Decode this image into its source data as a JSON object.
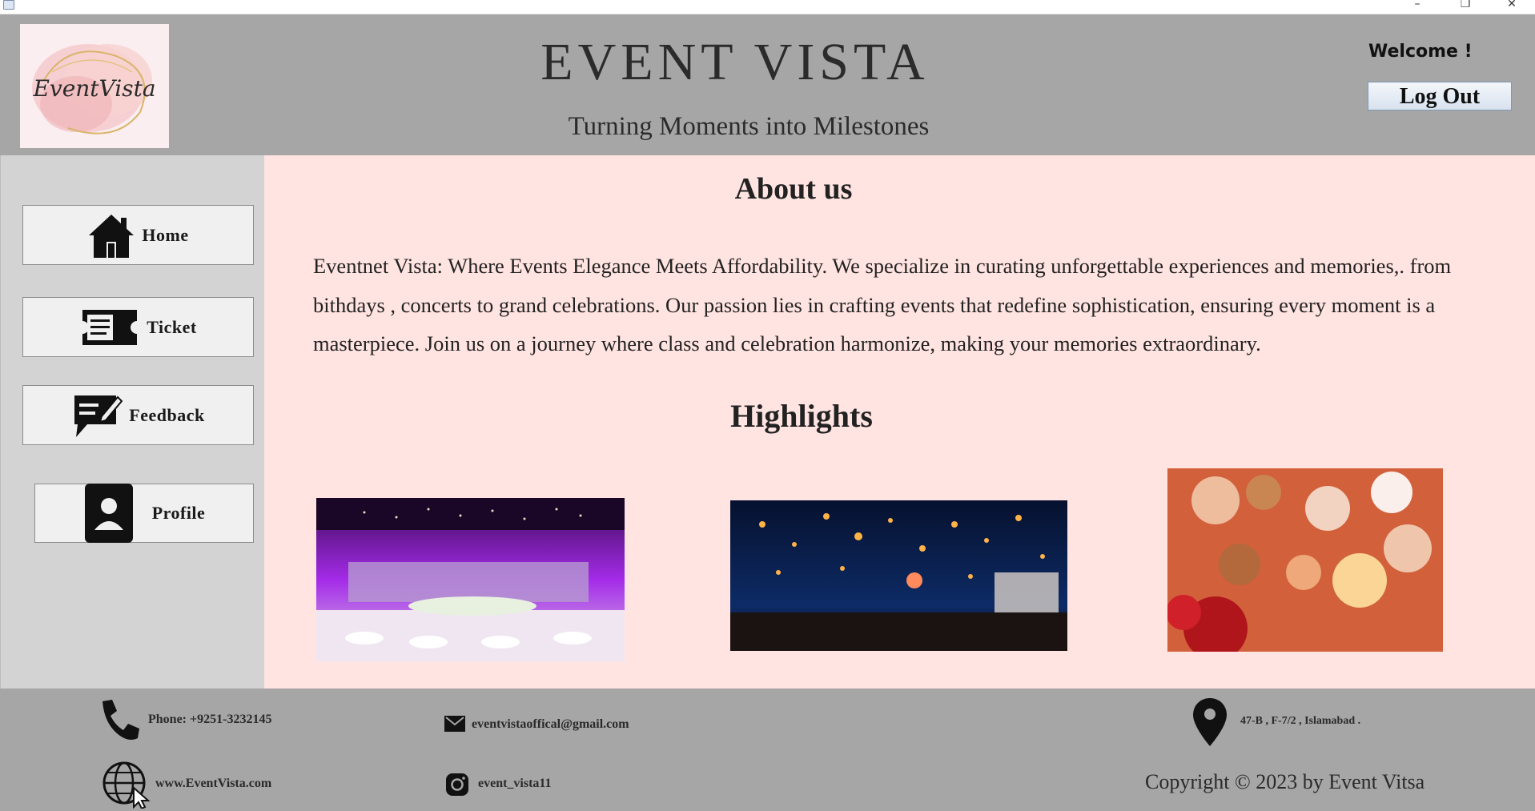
{
  "window": {
    "minimize": "–",
    "maximize": "❐",
    "close": "✕"
  },
  "header": {
    "logo_text": "EventVista",
    "title": "EVENT VISTA",
    "tagline": "Turning Moments into Milestones",
    "welcome": "Welcome !",
    "logout_label": "Log Out"
  },
  "sidebar": {
    "items": [
      {
        "label": "Home",
        "icon": "home-icon"
      },
      {
        "label": "Ticket",
        "icon": "ticket-icon"
      },
      {
        "label": "Feedback",
        "icon": "feedback-icon"
      },
      {
        "label": "Profile",
        "icon": "profile-icon"
      }
    ]
  },
  "main": {
    "about_heading": "About us",
    "about_text": "Eventnet Vista: Where Events Elegance Meets Affordability. We specialize in curating unforgettable experiences and memories,. from bithdays , concerts to grand celebrations. Our passion lies in crafting events that redefine sophistication, ensuring every moment is a masterpiece. Join us on a journey where class and celebration harmonize, making your memories extraordinary.",
    "highlights_heading": "Highlights"
  },
  "footer": {
    "phone": "Phone: +9251-3232145",
    "email": "eventvistaoffical@gmail.com",
    "address": "47-B , F-7/2  , Islamabad .",
    "website": "www.EventVista.com",
    "instagram": "event_vista11",
    "copyright": "Copyright © 2023 by Event Vitsa"
  }
}
